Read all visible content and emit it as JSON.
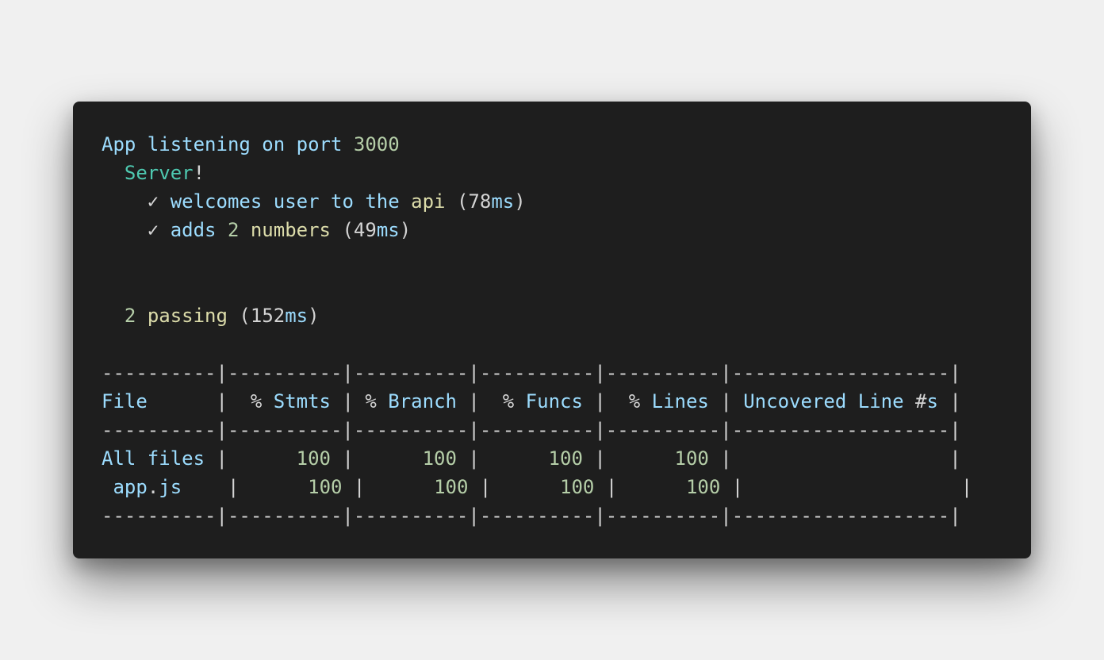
{
  "colors": {
    "background": "#1e1e1e",
    "page": "#f0f0f0",
    "blue": "#9cdcfe",
    "teal": "#4ec9b0",
    "green": "#b5cea8",
    "yellow": "#dcdcaa",
    "default": "#d4d4d4"
  },
  "log": {
    "listening_prefix": "App listening on port",
    "port": "3000",
    "suite_name": "Server",
    "suite_punct": "!",
    "check_icon": "✓",
    "tests": [
      {
        "parts": [
          "welcomes user to the",
          "api"
        ],
        "duration_value": "78",
        "duration_unit": "ms"
      },
      {
        "parts": [
          "adds",
          "2",
          "numbers"
        ],
        "duration_value": "49",
        "duration_unit": "ms"
      }
    ],
    "summary": {
      "count": "2",
      "label": "passing",
      "duration_value": "152",
      "duration_unit": "ms"
    }
  },
  "coverage": {
    "separator": "----------|----------|----------|----------|----------|-------------------|",
    "headers": {
      "file": "File",
      "stmts_pct": "%",
      "stmts": "Stmts",
      "branch_pct": "%",
      "branch": "Branch",
      "funcs_pct": "%",
      "funcs": "Funcs",
      "lines_pct": "%",
      "lines": "Lines",
      "uncovered_word1": "Uncovered Line",
      "uncovered_hash": "#",
      "uncovered_s": "s"
    },
    "rows": [
      {
        "file": "All files",
        "file_name": "All files",
        "file_dot": "",
        "file_ext": "",
        "stmts": "100",
        "branch": "100",
        "funcs": "100",
        "lines": "100",
        "uncovered": ""
      },
      {
        "file": "app.js",
        "file_name": "app",
        "file_dot": ".",
        "file_ext": "js",
        "stmts": "100",
        "branch": "100",
        "funcs": "100",
        "lines": "100",
        "uncovered": ""
      }
    ]
  }
}
